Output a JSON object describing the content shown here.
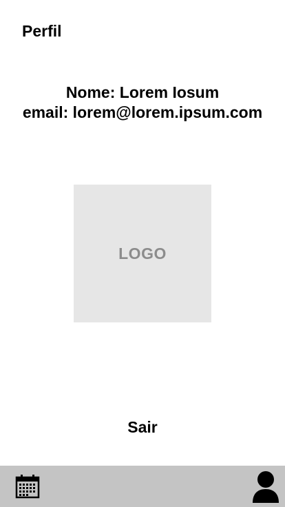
{
  "header": {
    "title": "Perfil"
  },
  "profile": {
    "name_line": "Nome: Lorem Iosum",
    "email_line": "email: lorem@lorem.ipsum.com"
  },
  "logo": {
    "text": "LOGO",
    "background": "#e6e6e6",
    "text_color": "#8c8c8c"
  },
  "actions": {
    "logout_label": "Sair"
  },
  "bottom_nav": {
    "background": "#c4c4c4",
    "items": [
      {
        "icon": "calendar-icon"
      },
      {
        "icon": "user-icon"
      }
    ]
  }
}
